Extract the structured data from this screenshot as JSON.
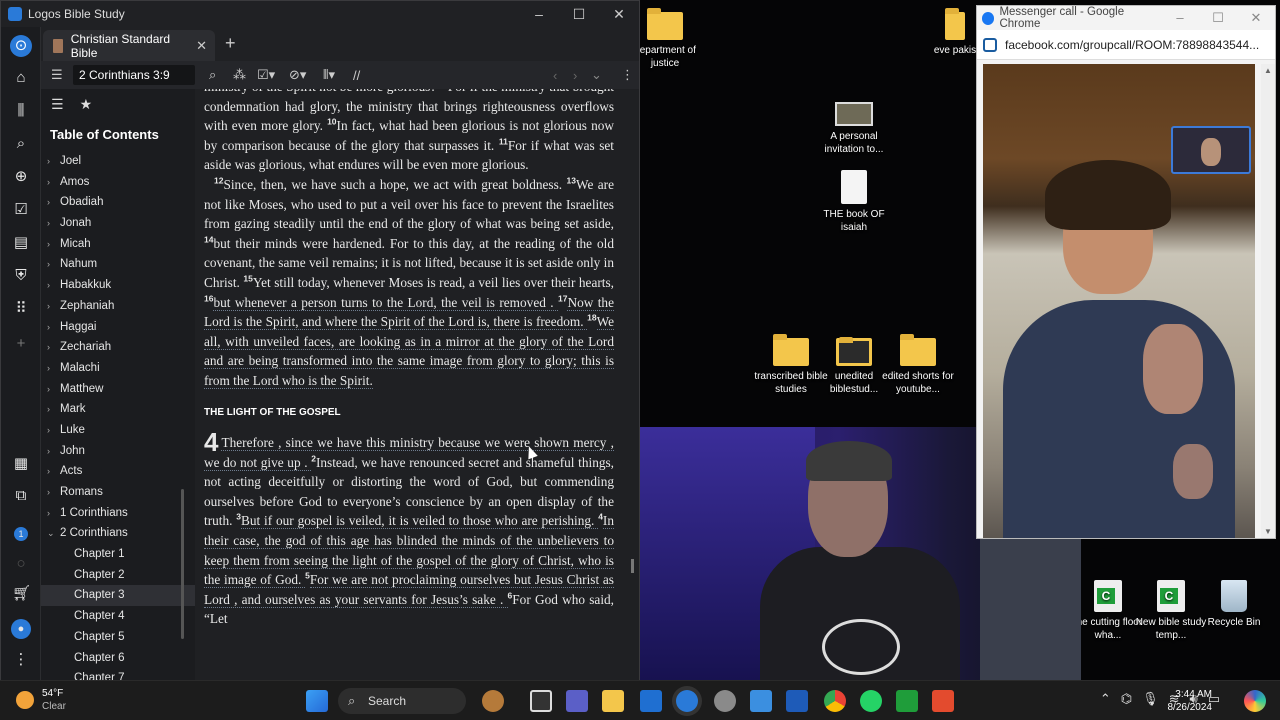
{
  "logos": {
    "app_title": "Logos Bible Study",
    "tab_label": "Christian Standard Bible",
    "reference": "2 Corinthians 3:9",
    "sidebar_title": "Table of Contents",
    "toc_items": [
      {
        "label": "Joel",
        "expanded": false
      },
      {
        "label": "Amos",
        "expanded": false
      },
      {
        "label": "Obadiah",
        "expanded": false
      },
      {
        "label": "Jonah",
        "expanded": false
      },
      {
        "label": "Micah",
        "expanded": false
      },
      {
        "label": "Nahum",
        "expanded": false
      },
      {
        "label": "Habakkuk",
        "expanded": false
      },
      {
        "label": "Zephaniah",
        "expanded": false
      },
      {
        "label": "Haggai",
        "expanded": false
      },
      {
        "label": "Zechariah",
        "expanded": false
      },
      {
        "label": "Malachi",
        "expanded": false
      },
      {
        "label": "Matthew",
        "expanded": false
      },
      {
        "label": "Mark",
        "expanded": false
      },
      {
        "label": "Luke",
        "expanded": false
      },
      {
        "label": "John",
        "expanded": false
      },
      {
        "label": "Acts",
        "expanded": false
      },
      {
        "label": "Romans",
        "expanded": false
      },
      {
        "label": "1 Corinthians",
        "expanded": false
      },
      {
        "label": "2 Corinthians",
        "expanded": true
      },
      {
        "label": "Chapter 1",
        "child": true
      },
      {
        "label": "Chapter 2",
        "child": true
      },
      {
        "label": "Chapter 3",
        "child": true,
        "selected": true
      },
      {
        "label": "Chapter 4",
        "child": true
      },
      {
        "label": "Chapter 5",
        "child": true
      },
      {
        "label": "Chapter 6",
        "child": true
      },
      {
        "label": "Chapter 7",
        "child": true
      }
    ],
    "section_heading": "THE LIGHT OF THE GOSPEL",
    "chapter_number": "4",
    "para1": "ministry of the Spirit not be more glorious? ⁹ For if the ministry that brought condemnation had glory, the ministry that brings righteousness overflows with even more glory. ",
    "para1_cont": "In fact, what had been glorious is not glorious now by comparison because of the glory that surpasses it. ",
    "para1_end": "For if what was set aside was glorious, what endures will be even more glorious.",
    "para2": "Since, then, we have such a hope, we act with great boldness. ",
    "para2_b": "We are not like Moses, who used to put a veil over his face to prevent the Israelites from gazing steadily until the end of the glory of what was being set aside, ",
    "para2_c": "but their minds were hardened. For to this day, at the reading of the old covenant, the same veil remains; it is not lifted, because it is set aside only in Christ. ",
    "para2_d": "Yet still today, whenever Moses is read, a veil lies over their hearts, ",
    "para2_e": "but whenever a person turns to the Lord, the veil is removed . ",
    "para2_f": "Now the Lord is the Spirit, and where the Spirit of the Lord is, there is freedom. ",
    "para2_g": "We all, with unveiled faces, are looking as in a mirror at the glory of the Lord and are being transformed into the same image from glory to glory; this is from the Lord who is the Spirit.",
    "ch4_a": "Therefore , since we have this ministry because we were shown mercy , we do not give up . ",
    "ch4_b": "Instead, we have renounced secret and shameful things, not acting deceitfully or distorting the word of God, but commending ourselves before God to everyone’s conscience by an open display of the truth. ",
    "ch4_c": "But if our gospel is veiled, it is veiled to those who are perishing. ",
    "ch4_d": "In their case, the god of this age has blinded the minds of the unbelievers to keep them from seeing the light of the gospel of the glory of Christ, who is the image of God. ",
    "ch4_e": "For we are not proclaiming ourselves but Jesus Christ as Lord , and ourselves as your servants for Jesus’s sake . ",
    "ch4_f": "For God who said, “Let"
  },
  "desktop_icons": [
    {
      "label": "department of justice",
      "type": "chrome-folder"
    },
    {
      "label": "eve pakis",
      "type": "folder"
    },
    {
      "label": "A personal invitation to...",
      "type": "video"
    },
    {
      "label": "THE book OF isaiah",
      "type": "document"
    },
    {
      "label": "transcribed bible studies",
      "type": "folder"
    },
    {
      "label": "unedited biblestud...",
      "type": "folder-dark"
    },
    {
      "label": "edited shorts for youtube...",
      "type": "folder"
    },
    {
      "label": "the cutting floor wha...",
      "type": "spreadsheet"
    },
    {
      "label": "New bible study temp...",
      "type": "spreadsheet"
    },
    {
      "label": "Recycle Bin",
      "type": "recycle-bin"
    }
  ],
  "chrome": {
    "title": "Messenger call - Google Chrome",
    "url": "facebook.com/groupcall/ROOM:78898843544..."
  },
  "taskbar": {
    "weather_temp": "54°F",
    "weather_desc": "Clear",
    "search_placeholder": "Search",
    "time": "3:44 AM",
    "date": "8/26/2024"
  },
  "colors": {
    "accent": "#2a7ad8",
    "footnote": "#6aa0e8",
    "reader_bg": "#1f2023"
  }
}
